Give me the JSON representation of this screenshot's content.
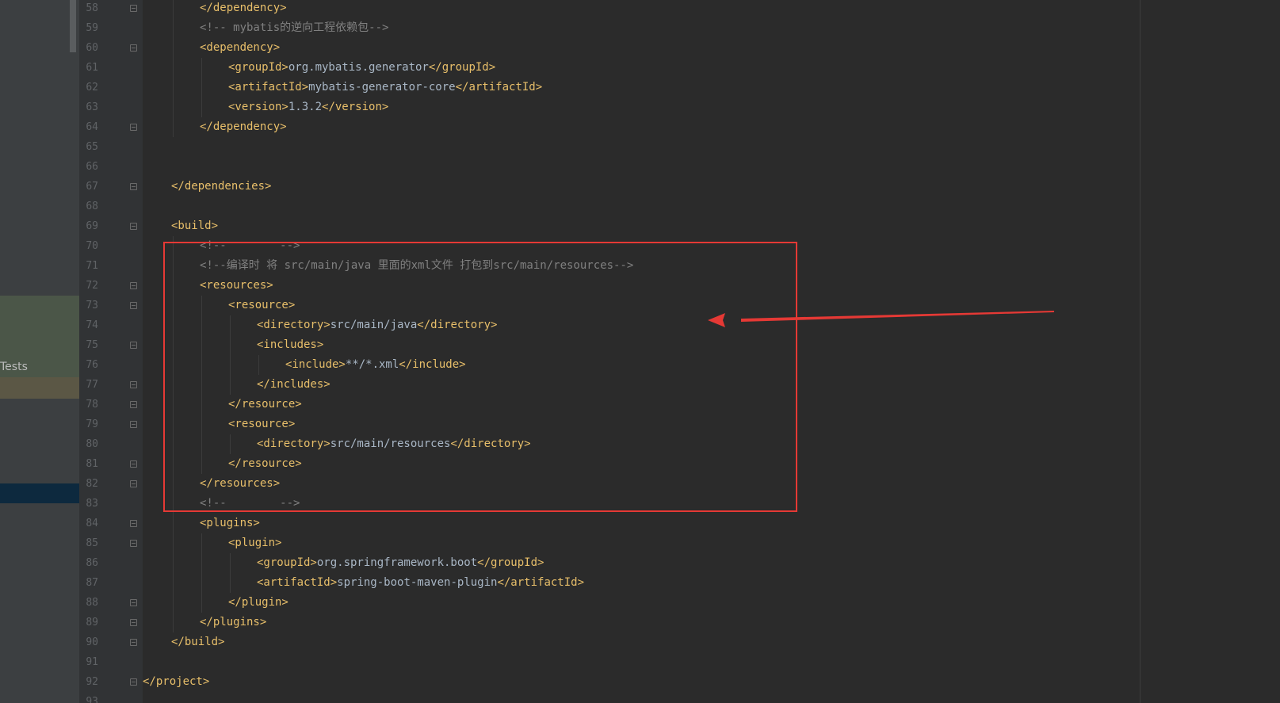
{
  "left_panel": {
    "tests_label": "Tests"
  },
  "code_lines": [
    {
      "num": "58",
      "tokens": [
        {
          "t": "tag",
          "v": "</dependency>"
        }
      ]
    },
    {
      "num": "59",
      "tokens": [
        {
          "t": "comment",
          "v": "<!-- mybatis的逆向工程依赖包-->"
        }
      ]
    },
    {
      "num": "60",
      "tokens": [
        {
          "t": "tag",
          "v": "<dependency>"
        }
      ]
    },
    {
      "num": "61",
      "tokens": [
        {
          "t": "tag",
          "v": "<groupId>"
        },
        {
          "t": "text",
          "v": "org.mybatis.generator"
        },
        {
          "t": "tag",
          "v": "</groupId>"
        }
      ]
    },
    {
      "num": "62",
      "tokens": [
        {
          "t": "tag",
          "v": "<artifactId>"
        },
        {
          "t": "text",
          "v": "mybatis-generator-core"
        },
        {
          "t": "tag",
          "v": "</artifactId>"
        }
      ]
    },
    {
      "num": "63",
      "tokens": [
        {
          "t": "tag",
          "v": "<version>"
        },
        {
          "t": "text",
          "v": "1.3.2"
        },
        {
          "t": "tag",
          "v": "</version>"
        }
      ]
    },
    {
      "num": "64",
      "tokens": [
        {
          "t": "tag",
          "v": "</dependency>"
        }
      ]
    },
    {
      "num": "65",
      "tokens": []
    },
    {
      "num": "66",
      "tokens": []
    },
    {
      "num": "67",
      "tokens": [
        {
          "t": "tag",
          "v": "</dependencies>"
        }
      ]
    },
    {
      "num": "68",
      "tokens": []
    },
    {
      "num": "69",
      "tokens": [
        {
          "t": "tag",
          "v": "<build>"
        }
      ]
    },
    {
      "num": "70",
      "tokens": [
        {
          "t": "comment",
          "v": "<!--        -->"
        }
      ]
    },
    {
      "num": "71",
      "tokens": [
        {
          "t": "comment",
          "v": "<!--编译时 将 src/main/java 里面的xml文件 打包到src/main/resources-->"
        }
      ]
    },
    {
      "num": "72",
      "tokens": [
        {
          "t": "tag",
          "v": "<resources>"
        }
      ]
    },
    {
      "num": "73",
      "tokens": [
        {
          "t": "tag",
          "v": "<resource>"
        }
      ]
    },
    {
      "num": "74",
      "tokens": [
        {
          "t": "tag",
          "v": "<directory>"
        },
        {
          "t": "text",
          "v": "src/main/java"
        },
        {
          "t": "tag",
          "v": "</directory>"
        }
      ]
    },
    {
      "num": "75",
      "tokens": [
        {
          "t": "tag",
          "v": "<includes>"
        }
      ]
    },
    {
      "num": "76",
      "tokens": [
        {
          "t": "tag",
          "v": "<include>"
        },
        {
          "t": "text",
          "v": "**/*.xml"
        },
        {
          "t": "tag",
          "v": "</include>"
        }
      ]
    },
    {
      "num": "77",
      "tokens": [
        {
          "t": "tag",
          "v": "</includes>"
        }
      ]
    },
    {
      "num": "78",
      "tokens": [
        {
          "t": "tag",
          "v": "</resource>"
        }
      ]
    },
    {
      "num": "79",
      "tokens": [
        {
          "t": "tag",
          "v": "<resource>"
        }
      ]
    },
    {
      "num": "80",
      "tokens": [
        {
          "t": "tag",
          "v": "<directory>"
        },
        {
          "t": "text",
          "v": "src/main/resources"
        },
        {
          "t": "tag",
          "v": "</directory>"
        }
      ]
    },
    {
      "num": "81",
      "tokens": [
        {
          "t": "tag",
          "v": "</resource>"
        }
      ]
    },
    {
      "num": "82",
      "tokens": [
        {
          "t": "tag",
          "v": "</resources>"
        }
      ]
    },
    {
      "num": "83",
      "tokens": [
        {
          "t": "comment",
          "v": "<!--        -->"
        }
      ]
    },
    {
      "num": "84",
      "tokens": [
        {
          "t": "tag",
          "v": "<plugins>"
        }
      ]
    },
    {
      "num": "85",
      "tokens": [
        {
          "t": "tag",
          "v": "<plugin>"
        }
      ]
    },
    {
      "num": "86",
      "tokens": [
        {
          "t": "tag",
          "v": "<groupId>"
        },
        {
          "t": "text",
          "v": "org.springframework.boot"
        },
        {
          "t": "tag",
          "v": "</groupId>"
        }
      ]
    },
    {
      "num": "87",
      "tokens": [
        {
          "t": "tag",
          "v": "<artifactId>"
        },
        {
          "t": "text",
          "v": "spring-boot-maven-plugin"
        },
        {
          "t": "tag",
          "v": "</artifactId>"
        }
      ]
    },
    {
      "num": "88",
      "tokens": [
        {
          "t": "tag",
          "v": "</plugin>"
        }
      ]
    },
    {
      "num": "89",
      "tokens": [
        {
          "t": "tag",
          "v": "</plugins>"
        }
      ]
    },
    {
      "num": "90",
      "tokens": [
        {
          "t": "tag",
          "v": "</build>"
        }
      ]
    },
    {
      "num": "91",
      "tokens": []
    },
    {
      "num": "92",
      "tokens": [
        {
          "t": "tag",
          "v": "</project>"
        }
      ]
    },
    {
      "num": "93",
      "tokens": []
    }
  ],
  "colors": {
    "tag": "#e8bf6a",
    "text": "#a9b7c6",
    "comment": "#808080",
    "annotation": "#e53935"
  }
}
